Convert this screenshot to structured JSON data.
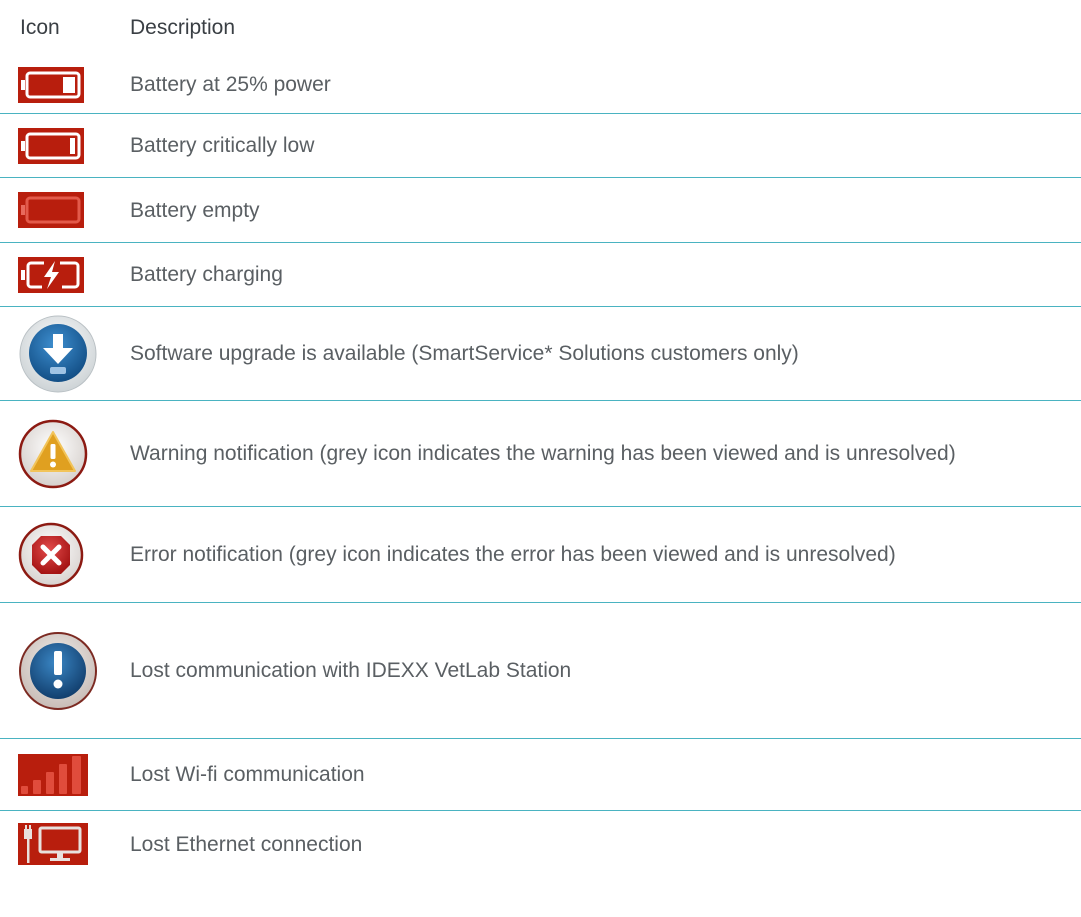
{
  "header": {
    "icon_label": "Icon",
    "description_label": "Description"
  },
  "rows": [
    {
      "icon": "battery-25-icon",
      "description": "Battery at 25% power"
    },
    {
      "icon": "battery-critical-icon",
      "description": "Battery critically low"
    },
    {
      "icon": "battery-empty-icon",
      "description": "Battery empty"
    },
    {
      "icon": "battery-charging-icon",
      "description": "Battery charging"
    },
    {
      "icon": "software-upgrade-icon",
      "description": "Software upgrade is available (SmartService* Solutions customers only)"
    },
    {
      "icon": "warning-icon",
      "description": "Warning notification (grey icon indicates the warning has been viewed and is unresolved)"
    },
    {
      "icon": "error-icon",
      "description": "Error notification (grey icon indicates the error has been viewed and is unresolved)"
    },
    {
      "icon": "lost-communication-icon",
      "description": "Lost communication with IDEXX VetLab Station"
    },
    {
      "icon": "lost-wifi-icon",
      "description": "Lost Wi-fi communication"
    },
    {
      "icon": "lost-ethernet-icon",
      "description": "Lost Ethernet connection"
    }
  ],
  "colors": {
    "icon_red": "#b81e0d",
    "divider": "#4ab3c1",
    "text": "#5a5f63"
  }
}
